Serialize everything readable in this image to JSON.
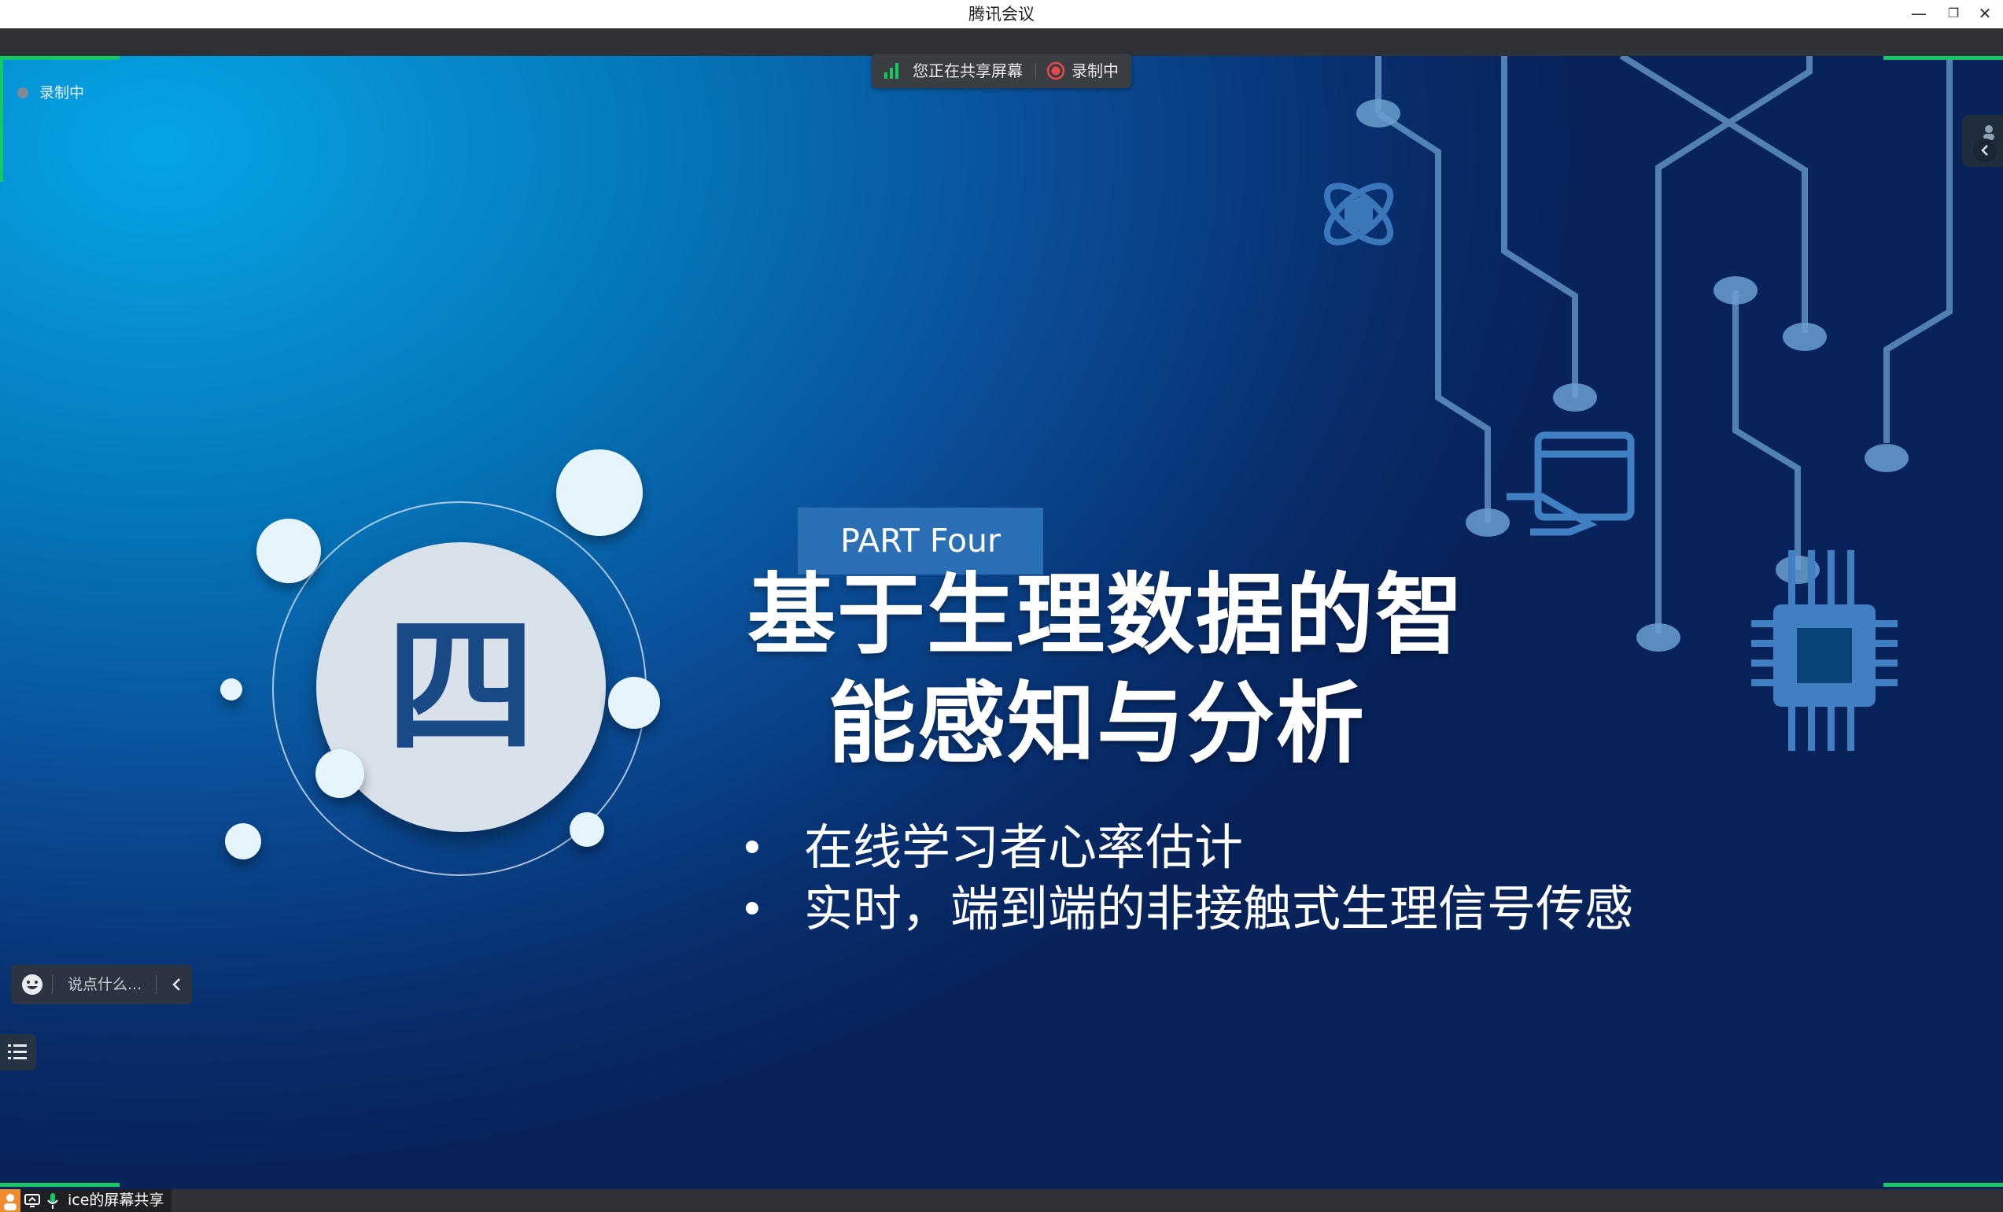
{
  "window": {
    "title": "腾讯会议",
    "controls": {
      "minimize": "—",
      "restore": "❐",
      "close": "✕"
    }
  },
  "share_bar": {
    "sharing_text": "您正在共享屏幕",
    "recording_text": "录制中"
  },
  "recording_indicator": {
    "label": "录制中"
  },
  "chat": {
    "placeholder": "说点什么..."
  },
  "bottom_bar": {
    "label": "ice的屏幕共享"
  },
  "slide": {
    "part_label": "PART Four",
    "numeral": "四",
    "title_line1": "基于生理数据的智",
    "title_line2": "能感知与分析",
    "bullets": [
      "在线学习者心率估计",
      "实时，端到端的非接触式生理信号传感"
    ]
  },
  "colors": {
    "accent_green": "#17c964",
    "record_red": "#e5484d",
    "slide_part_box": "#2b6fb6",
    "numeral_color": "#1a4a86"
  }
}
